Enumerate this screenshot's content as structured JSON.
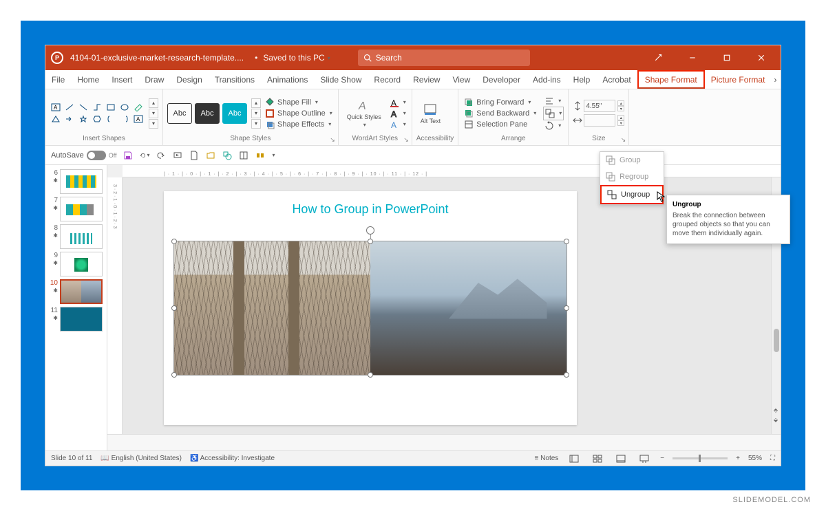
{
  "title_bar": {
    "filename": "4104-01-exclusive-market-research-template....",
    "save_status": "Saved to this PC",
    "search_placeholder": "Search"
  },
  "ribbon_tabs": [
    "File",
    "Home",
    "Insert",
    "Draw",
    "Design",
    "Transitions",
    "Animations",
    "Slide Show",
    "Record",
    "Review",
    "View",
    "Developer",
    "Add-ins",
    "Help",
    "Acrobat",
    "Shape Format",
    "Picture Format"
  ],
  "ribbon": {
    "insert_shapes_label": "Insert Shapes",
    "shape_styles_label": "Shape Styles",
    "wordart_label": "WordArt Styles",
    "accessibility_label": "Accessibility",
    "arrange_label": "Arrange",
    "size_label": "Size",
    "abc": "Abc",
    "shape_fill": "Shape Fill",
    "shape_outline": "Shape Outline",
    "shape_effects": "Shape Effects",
    "quick_styles": "Quick Styles",
    "alt_text": "Alt Text",
    "bring_forward": "Bring Forward",
    "send_backward": "Send Backward",
    "selection_pane": "Selection Pane",
    "height_value": "4.55\""
  },
  "qat": {
    "autosave": "AutoSave",
    "off": "Off"
  },
  "thumbs": [
    {
      "num": "6"
    },
    {
      "num": "7"
    },
    {
      "num": "8"
    },
    {
      "num": "9"
    },
    {
      "num": "10",
      "selected": true
    },
    {
      "num": "11"
    }
  ],
  "slide": {
    "title": "How to Group in PowerPoint"
  },
  "ruler_h": "| · 1 · | · 0 · | · 1 · | · 2 · | · 3 · | · 4 · | · 5 · | · 6 · | · 7 · | · 8 · | · 9 · | · 10 · | · 11 · | · 12 · |",
  "ruler_v": "3 · 2 · 1 · 0 · 1 · 2 · 3",
  "status": {
    "slide_count": "Slide 10 of 11",
    "language": "English (United States)",
    "accessibility": "Accessibility: Investigate",
    "notes": "Notes",
    "zoom": "55%"
  },
  "dropdown": {
    "group": "Group",
    "regroup": "Regroup",
    "ungroup": "Ungroup"
  },
  "tooltip": {
    "title": "Ungroup",
    "body": "Break the connection between grouped objects so that you can move them individually again."
  },
  "watermark": "SLIDEMODEL.COM"
}
